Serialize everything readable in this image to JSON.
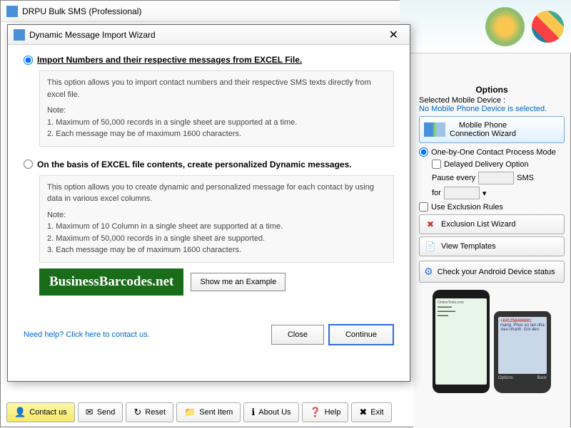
{
  "window": {
    "title": "DRPU Bulk SMS (Professional)"
  },
  "dialog": {
    "title": "Dynamic Message Import Wizard",
    "option1": {
      "label": "Import Numbers and their respective messages from EXCEL File.",
      "desc": "This option allows you to import contact numbers and their respective SMS texts directly from excel file.",
      "note_label": "Note:",
      "note1": "1. Maximum of 50,000 records in a single sheet are supported at a time.",
      "note2": "2. Each message may be of maximum 1600 characters."
    },
    "option2": {
      "label": "On the basis of EXCEL file contents, create personalized Dynamic messages.",
      "desc": "This option allows you to create dynamic and personalized message for each contact by using data in various excel columns.",
      "note_label": "Note:",
      "note1": "1. Maximum of 10 Column in a single sheet are supported at a time.",
      "note2": "2. Maximum of 50,000 records in a single sheet are supported.",
      "note3": "3. Each message may be of maximum 1600 characters."
    },
    "banner": "BusinessBarcodes.net",
    "example_btn": "Show me an Example",
    "help_link": "Need help? Click here to contact us.",
    "close_btn": "Close",
    "continue_btn": "Continue"
  },
  "options": {
    "title": "Options",
    "device_label": "Selected Mobile Device :",
    "device_status": "No Mobile Phone Device is selected.",
    "wizard_btn_l1": "Mobile Phone",
    "wizard_btn_l2": "Connection  Wizard",
    "mode_radio": "One-by-One Contact Process Mode",
    "delayed_check": "Delayed Delivery Option",
    "pause_label": "Pause every",
    "pause_unit": "SMS",
    "for_label": "for",
    "exclusion_check": "Use Exclusion Rules",
    "exclusion_btn": "Exclusion List Wizard",
    "templates_btn": "View Templates",
    "status_btn": "Check your Android Device status"
  },
  "phone2": {
    "number": "+841258486881",
    "text": "mang. Phuc vu tan nha sieu nhanh. Goi den:",
    "opt": "Options",
    "back": "Back"
  },
  "toolbar": {
    "contact": "Contact us",
    "send": "Send",
    "reset": "Reset",
    "sent_item": "Sent Item",
    "about": "About Us",
    "help": "Help",
    "exit": "Exit"
  }
}
